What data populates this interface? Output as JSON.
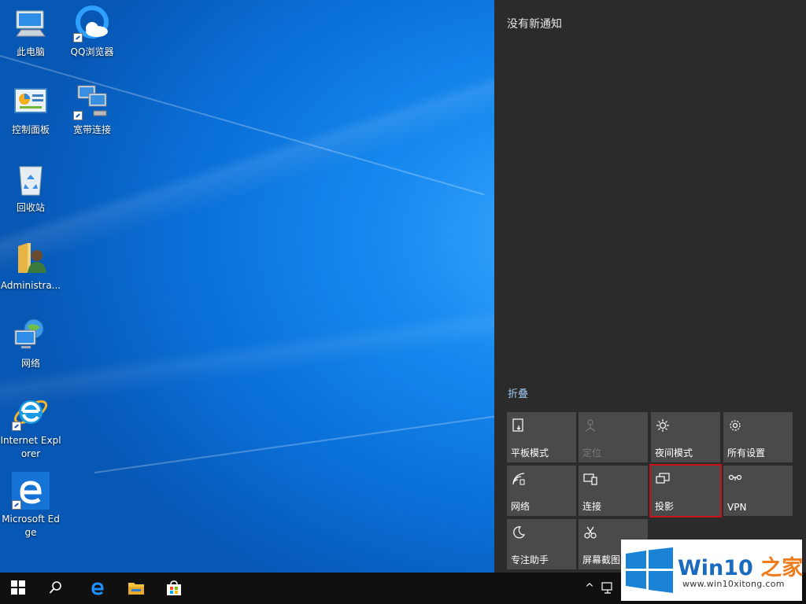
{
  "desktop": {
    "icons": [
      {
        "label": "此电脑",
        "icon": "computer-icon"
      },
      {
        "label": "QQ浏览器",
        "icon": "qq-browser-icon"
      },
      {
        "label": "控制面板",
        "icon": "control-panel-icon"
      },
      {
        "label": "宽带连接",
        "icon": "broadband-connection-icon"
      },
      {
        "label": "回收站",
        "icon": "recycle-bin-icon"
      },
      {
        "label": "Administra...",
        "icon": "user-folder-icon"
      },
      {
        "label": "网络",
        "icon": "network-icon"
      },
      {
        "label": "Internet Explorer",
        "icon": "internet-explorer-icon"
      },
      {
        "label": "Microsoft Edge",
        "icon": "edge-icon"
      }
    ]
  },
  "action_center": {
    "notification_text": "没有新通知",
    "collapse_label": "折叠",
    "tiles": [
      {
        "label": "平板模式",
        "icon": "tablet-mode-icon",
        "enabled": true
      },
      {
        "label": "定位",
        "icon": "location-icon",
        "enabled": false
      },
      {
        "label": "夜间模式",
        "icon": "night-light-icon",
        "enabled": true
      },
      {
        "label": "所有设置",
        "icon": "settings-gear-icon",
        "enabled": true
      },
      {
        "label": "网络",
        "icon": "network-wifi-icon",
        "enabled": true
      },
      {
        "label": "连接",
        "icon": "connect-icon",
        "enabled": true
      },
      {
        "label": "投影",
        "icon": "project-icon",
        "enabled": true,
        "highlighted": true
      },
      {
        "label": "VPN",
        "icon": "vpn-icon",
        "enabled": true
      },
      {
        "label": "专注助手",
        "icon": "focus-assist-moon-icon",
        "enabled": true
      },
      {
        "label": "屏幕截图",
        "icon": "screen-snip-icon",
        "enabled": true
      }
    ],
    "highlight_color": "#c8111b"
  },
  "taskbar": {
    "buttons": [
      "start-icon",
      "search-icon",
      "edge-icon",
      "file-explorer-icon",
      "store-icon"
    ],
    "tray_chevron": "^"
  },
  "watermark": {
    "title_main": "Win10",
    "title_accent": "之家",
    "url": "www.win10xitong.com",
    "brand_color": "#1a6bbf",
    "accent_color": "#f07c1d"
  }
}
